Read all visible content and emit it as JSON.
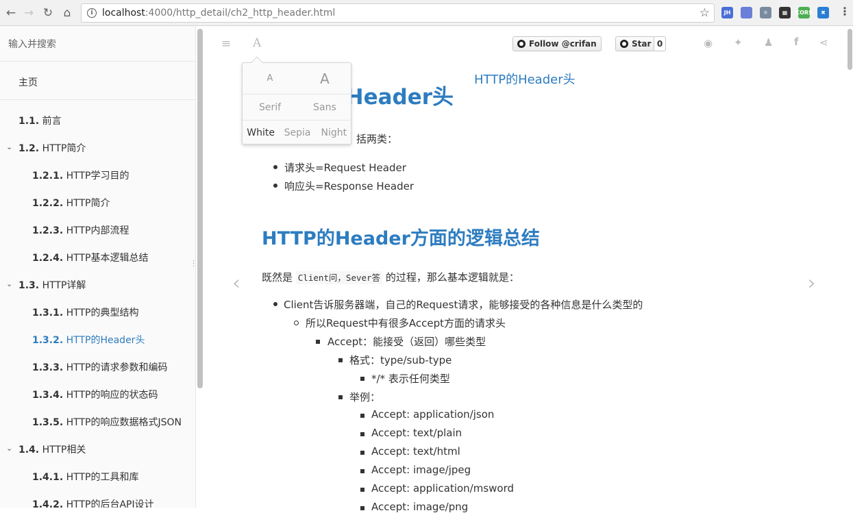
{
  "browser": {
    "url_host": "localhost",
    "url_path": ":4000/http_detail/ch2_http_header.html",
    "extensions": [
      {
        "name": "jh-extension-icon",
        "label": "JH",
        "color": "#4a6fd8"
      },
      {
        "name": "extension-2-icon",
        "label": "",
        "color": "#6b7fd8"
      },
      {
        "name": "react-devtools-icon",
        "label": "⚛",
        "color": "#7a8aa0"
      },
      {
        "name": "qr-code-icon",
        "label": "▦",
        "color": "#333333"
      },
      {
        "name": "cors-extension-icon",
        "label": "CORS",
        "color": "#4caf50"
      },
      {
        "name": "extension-6-icon",
        "label": "✖",
        "color": "#2a7fd4"
      }
    ]
  },
  "sidebar": {
    "search_placeholder": "输入并搜索",
    "home": "主页",
    "items": [
      {
        "num": "1.1.",
        "label": "前言",
        "level": 1,
        "chevron": false,
        "active": false
      },
      {
        "num": "1.2.",
        "label": "HTTP简介",
        "level": 1,
        "chevron": true,
        "active": false
      },
      {
        "num": "1.2.1.",
        "label": "HTTP学习目的",
        "level": 2,
        "chevron": false,
        "active": false
      },
      {
        "num": "1.2.2.",
        "label": "HTTP简介",
        "level": 2,
        "chevron": false,
        "active": false
      },
      {
        "num": "1.2.3.",
        "label": "HTTP内部流程",
        "level": 2,
        "chevron": false,
        "active": false
      },
      {
        "num": "1.2.4.",
        "label": "HTTP基本逻辑总结",
        "level": 2,
        "chevron": false,
        "active": false
      },
      {
        "num": "1.3.",
        "label": "HTTP详解",
        "level": 1,
        "chevron": true,
        "active": false
      },
      {
        "num": "1.3.1.",
        "label": "HTTP的典型结构",
        "level": 2,
        "chevron": false,
        "active": false
      },
      {
        "num": "1.3.2.",
        "label": "HTTP的Header头",
        "level": 2,
        "chevron": false,
        "active": true
      },
      {
        "num": "1.3.3.",
        "label": "HTTP的请求参数和编码",
        "level": 2,
        "chevron": false,
        "active": false
      },
      {
        "num": "1.3.4.",
        "label": "HTTP的响应的状态码",
        "level": 2,
        "chevron": false,
        "active": false
      },
      {
        "num": "1.3.5.",
        "label": "HTTP的响应数据格式JSON",
        "level": 2,
        "chevron": false,
        "active": false
      },
      {
        "num": "1.4.",
        "label": "HTTP相关",
        "level": 1,
        "chevron": true,
        "active": false
      },
      {
        "num": "1.4.1.",
        "label": "HTTP的工具和库",
        "level": 2,
        "chevron": false,
        "active": false
      },
      {
        "num": "1.4.2.",
        "label": "HTTP的后台API设计",
        "level": 2,
        "chevron": false,
        "active": false
      }
    ]
  },
  "toolbar": {
    "follow_label": "Follow @crifan",
    "star_label": "Star",
    "star_count": "0"
  },
  "font_popup": {
    "size_small": "A",
    "size_large": "A",
    "font_serif": "Serif",
    "font_sans": "Sans",
    "theme_white": "White",
    "theme_sepia": "Sepia",
    "theme_night": "Night"
  },
  "page": {
    "header_title": "HTTP的Header头",
    "h1": "HTTP的Header头",
    "intro": "HTTP的Header，包括两类：",
    "intro_visible": "括两类：",
    "intro_items": [
      "请求头=Request Header",
      "响应头=Response Header"
    ],
    "h2": "HTTP的Header方面的逻辑总结",
    "para_prefix": "既然是 ",
    "para_code": "Client问，Sever答",
    "para_suffix": " 的过程，那么基本逻辑就是：",
    "list": {
      "l1": "Client告诉服务器端，自己的Request请求，能够接受的各种信息是什么类型的",
      "l2": "所以Request中有很多Accept方面的请求头",
      "l3": "Accept：能接受（返回）哪些类型",
      "format_label": "格式：type/sub-type",
      "format_sub": "*/* 表示任何类型",
      "example_label": "举例：",
      "examples": [
        "Accept: application/json",
        "Accept: text/plain",
        "Accept: text/html",
        "Accept: image/jpeg",
        "Accept: application/msword",
        "Accept: image/png"
      ]
    }
  }
}
